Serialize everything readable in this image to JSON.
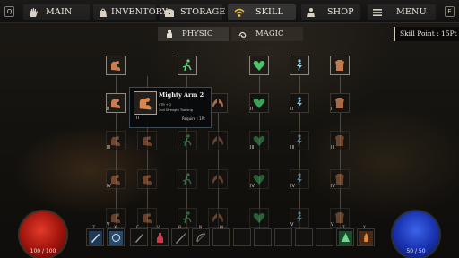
{
  "nav": {
    "left_key": "Q",
    "right_key": "E",
    "tabs": [
      {
        "label": "MAIN",
        "icon": "hand-icon"
      },
      {
        "label": "INVENTORY",
        "icon": "bag-icon"
      },
      {
        "label": "STORAGE",
        "icon": "chest-icon"
      },
      {
        "label": "SKILL",
        "icon": "wifi-icon"
      },
      {
        "label": "SHOP",
        "icon": "merchant-icon"
      },
      {
        "label": "MENU",
        "icon": "hamburger-icon"
      }
    ],
    "active_tab": "SKILL"
  },
  "sub_tabs": [
    {
      "label": "PHYSIC",
      "icon": "punch-icon"
    },
    {
      "label": "MAGIC",
      "icon": "swirl-icon"
    }
  ],
  "skill_points": "Skill Point : 15Pt",
  "skill_levels": {
    "arm_col": [
      "II",
      "III",
      "IV",
      "V"
    ],
    "col3": [
      "II",
      "III",
      "IV"
    ],
    "col4": [
      "II",
      "III",
      "IV",
      "V"
    ],
    "col5": [
      "II",
      "III",
      "IV",
      "V"
    ]
  },
  "tooltip": {
    "name": "Mighty Arm 2",
    "stat": "STR + 2",
    "desc": "2nd Strength Training",
    "require": "Require : 1Pt",
    "level": "II"
  },
  "hp": "100 / 100",
  "mp": "50 / 50",
  "hotbar": {
    "keys": [
      "Z",
      "X",
      "C",
      "V",
      "B",
      "N",
      "M",
      "",
      "",
      "",
      "",
      "",
      "T",
      "Y"
    ]
  },
  "colors": {
    "hp": "#c21f15",
    "mp": "#2a47d0",
    "strength_skill": "#c8744a",
    "agility_skill": "#55c777",
    "vitality_skill": "#4ec46a"
  }
}
